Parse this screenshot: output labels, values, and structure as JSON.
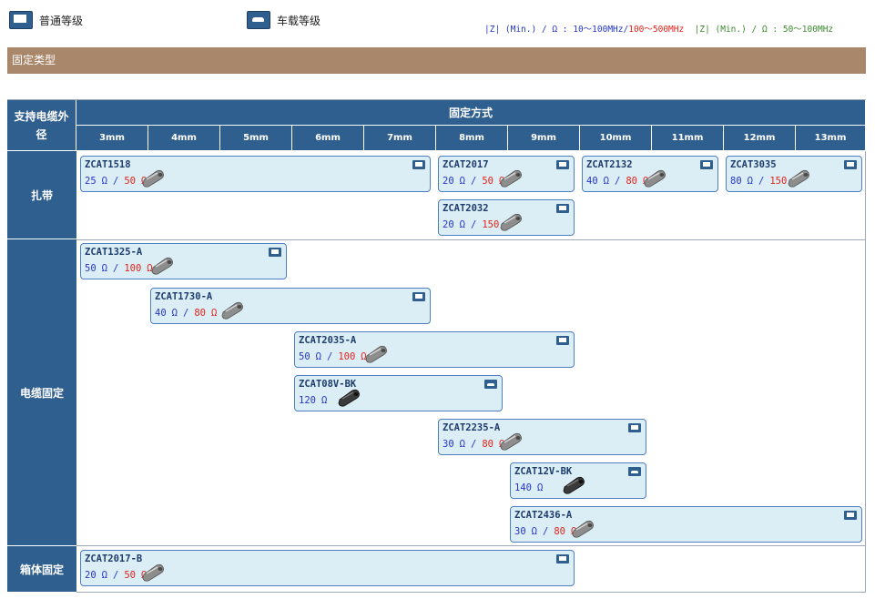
{
  "legend": {
    "standard_label": "普通等级",
    "standard_icon": "monitor-icon",
    "automotive_label": "车载等级",
    "automotive_icon": "car-icon"
  },
  "spec_note": {
    "prefix1": "|Z| (Min.) / Ω : 10〜100MHz/",
    "hf1": "100〜500MHz",
    "prefix2": "  |Z| (Min.) / Ω : 50〜100MHz",
    "colors": {
      "low_band": "#2536c8",
      "high_band": "#e2231a",
      "green_band": "#3c8a2e"
    }
  },
  "banner": {
    "title": "固定类型"
  },
  "table": {
    "corner_header": "支持电缆外径",
    "method_header": "固定方式",
    "columns": [
      "3mm",
      "4mm",
      "5mm",
      "6mm",
      "7mm",
      "8mm",
      "9mm",
      "10mm",
      "11mm",
      "12mm",
      "13mm"
    ],
    "rows": [
      {
        "label": "扎带"
      },
      {
        "label": "电缆固定"
      },
      {
        "label": "箱体固定"
      }
    ]
  },
  "products": [
    {
      "name": "ZCAT1518",
      "z1": "25",
      "z2": "50",
      "grade": "screen"
    },
    {
      "name": "ZCAT2017",
      "z1": "20",
      "z2": "50",
      "grade": "screen"
    },
    {
      "name": "ZCAT2132",
      "z1": "40",
      "z2": "80",
      "grade": "screen"
    },
    {
      "name": "ZCAT3035",
      "z1": "80",
      "z2": "150",
      "grade": "screen"
    },
    {
      "name": "ZCAT2032",
      "z1": "20",
      "z2": "150",
      "grade": "screen"
    },
    {
      "name": "ZCAT1325-A",
      "z1": "50",
      "z2": "100",
      "grade": "screen"
    },
    {
      "name": "ZCAT1730-A",
      "z1": "40",
      "z2": "80",
      "grade": "screen"
    },
    {
      "name": "ZCAT2035-A",
      "z1": "50",
      "z2": "100",
      "grade": "screen"
    },
    {
      "name": "ZCAT08V-BK",
      "z1": "120",
      "z2": "",
      "grade": "car"
    },
    {
      "name": "ZCAT2235-A",
      "z1": "30",
      "z2": "80",
      "grade": "screen"
    },
    {
      "name": "ZCAT12V-BK",
      "z1": "140",
      "z2": "",
      "grade": "car"
    },
    {
      "name": "ZCAT2436-A",
      "z1": "30",
      "z2": "80",
      "grade": "screen"
    },
    {
      "name": "ZCAT2017-B",
      "z1": "20",
      "z2": "50",
      "grade": "screen"
    }
  ],
  "unit": "Ω",
  "slash": "/"
}
